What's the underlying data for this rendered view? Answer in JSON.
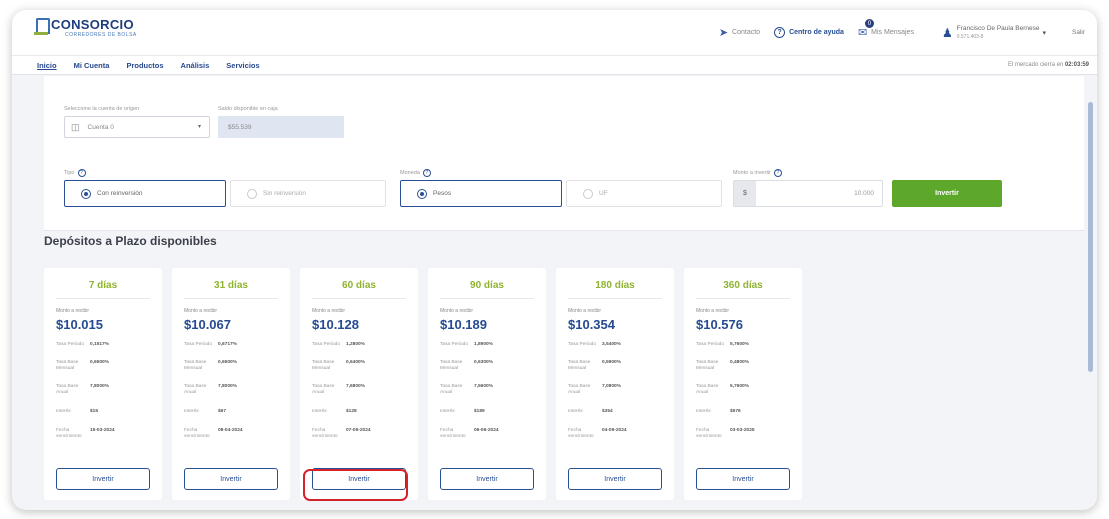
{
  "header": {
    "logo_name": "CONSORCIO",
    "logo_sub": "CORREDORES DE BOLSA",
    "contact": "Contacto",
    "help": "Centro de ayuda",
    "messages": "Mis Mensajes",
    "message_count": "0",
    "user_name": "Francisco De Paula Bernese",
    "user_rut": "9.571.403-8",
    "logout": "Salir"
  },
  "nav": {
    "items": [
      "Inicio",
      "Mi Cuenta",
      "Productos",
      "Análisis",
      "Servicios"
    ],
    "market_note": "El mercado cierra en",
    "market_time": "02:03:59"
  },
  "form": {
    "account_label": "Seleccione la cuenta de origen",
    "account_value": "Cuenta 0",
    "balance_label": "Saldo disponible en caja",
    "balance_value": "$55.539",
    "type_label": "Tipo",
    "type_options": [
      "Con reinversión",
      "Sin reinversión"
    ],
    "currency_label": "Moneda",
    "currency_options": [
      "Pesos",
      "UF"
    ],
    "amount_label": "Monto a invertir",
    "amount_prefix": "$",
    "amount_value": "10.000",
    "invest_button": "Invertir"
  },
  "section_title": "Depósitos a Plazo disponibles",
  "cards": [
    {
      "title": "7 días",
      "amount_label": "Monto a recibir",
      "amount": "$10.015",
      "tasa_periodo": "0,1517%",
      "tasa_mensual": "0,6500%",
      "tasa_anual": "7,8000%",
      "interes": "$15",
      "fecha": "15-03-2024",
      "button": "Invertir"
    },
    {
      "title": "31 días",
      "amount_label": "Monto a recibir",
      "amount": "$10.067",
      "tasa_periodo": "0,6717%",
      "tasa_mensual": "0,6500%",
      "tasa_anual": "7,8000%",
      "interes": "$67",
      "fecha": "08-04-2024",
      "button": "Invertir"
    },
    {
      "title": "60 días",
      "amount_label": "Monto a recibir",
      "amount": "$10.128",
      "tasa_periodo": "1,2800%",
      "tasa_mensual": "0,6400%",
      "tasa_anual": "7,6800%",
      "interes": "$128",
      "fecha": "07-05-2024",
      "button": "Invertir"
    },
    {
      "title": "90 días",
      "amount_label": "Monto a recibir",
      "amount": "$10.189",
      "tasa_periodo": "1,8900%",
      "tasa_mensual": "0,6300%",
      "tasa_anual": "7,5600%",
      "interes": "$189",
      "fecha": "06-06-2024",
      "button": "Invertir"
    },
    {
      "title": "180 días",
      "amount_label": "Monto a recibir",
      "amount": "$10.354",
      "tasa_periodo": "3,5400%",
      "tasa_mensual": "0,5900%",
      "tasa_anual": "7,0800%",
      "interes": "$354",
      "fecha": "04-09-2024",
      "button": "Invertir"
    },
    {
      "title": "360 días",
      "amount_label": "Monto a recibir",
      "amount": "$10.576",
      "tasa_periodo": "5,7600%",
      "tasa_mensual": "0,4800%",
      "tasa_anual": "5,7600%",
      "interes": "$576",
      "fecha": "03-03-2025",
      "button": "Invertir"
    }
  ],
  "row_labels": {
    "tasa_periodo": "Tasa Periodo",
    "tasa_mensual": "Tasa Base Mensual",
    "tasa_anual": "Tasa Base Anual",
    "interes": "Interés",
    "fecha": "Fecha vencimiento"
  }
}
